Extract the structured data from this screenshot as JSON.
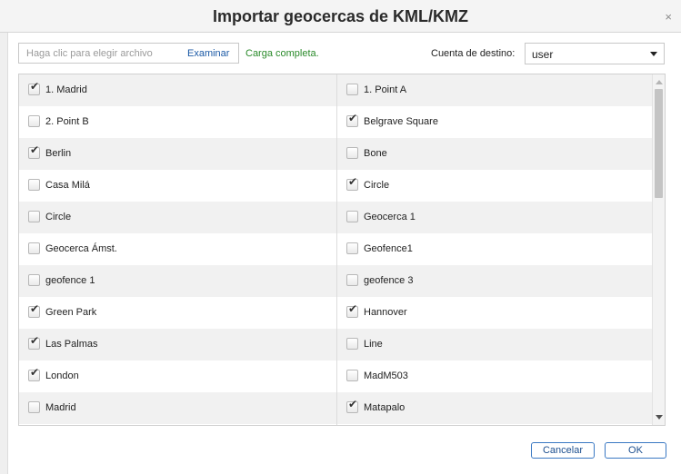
{
  "dialog": {
    "title": "Importar geocercas de KML/KMZ",
    "close_label": "×"
  },
  "file": {
    "placeholder": "Haga clic para elegir archivo",
    "browse_label": "Examinar",
    "status": "Carga completa."
  },
  "account": {
    "label": "Cuenta de destino:",
    "selected": "user"
  },
  "checkmark": "✔",
  "rows": [
    {
      "left": {
        "label": "1. Madrid",
        "checked": true
      },
      "right": {
        "label": "1. Point A",
        "checked": false
      }
    },
    {
      "left": {
        "label": "2. Point B",
        "checked": false
      },
      "right": {
        "label": "Belgrave Square",
        "checked": true
      }
    },
    {
      "left": {
        "label": "Berlin",
        "checked": true
      },
      "right": {
        "label": "Bone",
        "checked": false
      }
    },
    {
      "left": {
        "label": "Casa Milá",
        "checked": false
      },
      "right": {
        "label": "Circle",
        "checked": true
      }
    },
    {
      "left": {
        "label": "Circle",
        "checked": false
      },
      "right": {
        "label": "Geocerca 1",
        "checked": false
      }
    },
    {
      "left": {
        "label": "Geocerca Ámst.",
        "checked": false
      },
      "right": {
        "label": "Geofence1",
        "checked": false
      }
    },
    {
      "left": {
        "label": "geofence 1",
        "checked": false
      },
      "right": {
        "label": "geofence 3",
        "checked": false
      }
    },
    {
      "left": {
        "label": "Green Park",
        "checked": true
      },
      "right": {
        "label": "Hannover",
        "checked": true
      }
    },
    {
      "left": {
        "label": "Las Palmas",
        "checked": true
      },
      "right": {
        "label": "Line",
        "checked": false
      }
    },
    {
      "left": {
        "label": "London",
        "checked": true
      },
      "right": {
        "label": "MadM503",
        "checked": false
      }
    },
    {
      "left": {
        "label": "Madrid",
        "checked": false
      },
      "right": {
        "label": "Matapalo",
        "checked": true
      }
    },
    {
      "left": {
        "label": "",
        "checked": false
      },
      "right": {
        "label": "",
        "checked": false
      }
    }
  ],
  "buttons": {
    "cancel": "Cancelar",
    "ok": "OK"
  }
}
